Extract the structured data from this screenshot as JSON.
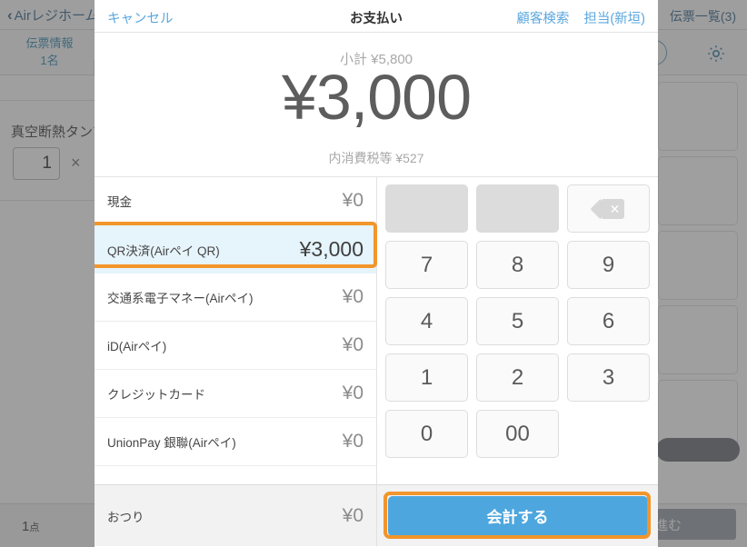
{
  "background": {
    "home_button": "Airレジホーム",
    "back_chevron": "‹",
    "slip_list": "伝票一覧(3)",
    "slip_info_line1": "伝票情報",
    "slip_info_line2": "1名",
    "item_name": "真空断熱タンブ",
    "item_qty": "1",
    "item_multiply": "×",
    "bottom_count": "1",
    "bottom_count_unit": "点",
    "next_button": "進む"
  },
  "modal": {
    "cancel_label": "キャンセル",
    "title": "お支払い",
    "customer_search_label": "顧客検索",
    "staff_label": "担当(新垣)",
    "subtotal_text": "小計 ¥5,800",
    "amount_display": "¥3,000",
    "tax_note": "内消費税等 ¥527",
    "payment_methods": [
      {
        "label": "現金",
        "value": "¥0",
        "selected": false
      },
      {
        "label": "QR決済(Airペイ QR)",
        "value": "¥3,000",
        "selected": true
      },
      {
        "label": "交通系電子マネー(Airペイ)",
        "value": "¥0",
        "selected": false
      },
      {
        "label": "iD(Airペイ)",
        "value": "¥0",
        "selected": false
      },
      {
        "label": "クレジットカード",
        "value": "¥0",
        "selected": false
      },
      {
        "label": "UnionPay 銀聯(Airペイ)",
        "value": "¥0",
        "selected": false
      }
    ],
    "keypad": [
      {
        "label": "",
        "kind": "blank"
      },
      {
        "label": "",
        "kind": "blank"
      },
      {
        "label": "",
        "kind": "backspace"
      },
      {
        "label": "7",
        "kind": "digit"
      },
      {
        "label": "8",
        "kind": "digit"
      },
      {
        "label": "9",
        "kind": "digit"
      },
      {
        "label": "4",
        "kind": "digit"
      },
      {
        "label": "5",
        "kind": "digit"
      },
      {
        "label": "6",
        "kind": "digit"
      },
      {
        "label": "1",
        "kind": "digit"
      },
      {
        "label": "2",
        "kind": "digit"
      },
      {
        "label": "3",
        "kind": "digit"
      },
      {
        "label": "0",
        "kind": "digit"
      },
      {
        "label": "00",
        "kind": "digit"
      },
      {
        "label": "",
        "kind": "empty"
      }
    ],
    "change_label": "おつり",
    "change_value": "¥0",
    "confirm_button": "会計する"
  },
  "colors": {
    "accent_blue": "#4ea6de",
    "link_blue": "#5ba7de",
    "highlight_orange": "#f2952b",
    "selected_row_bg": "#e6f4fb"
  }
}
